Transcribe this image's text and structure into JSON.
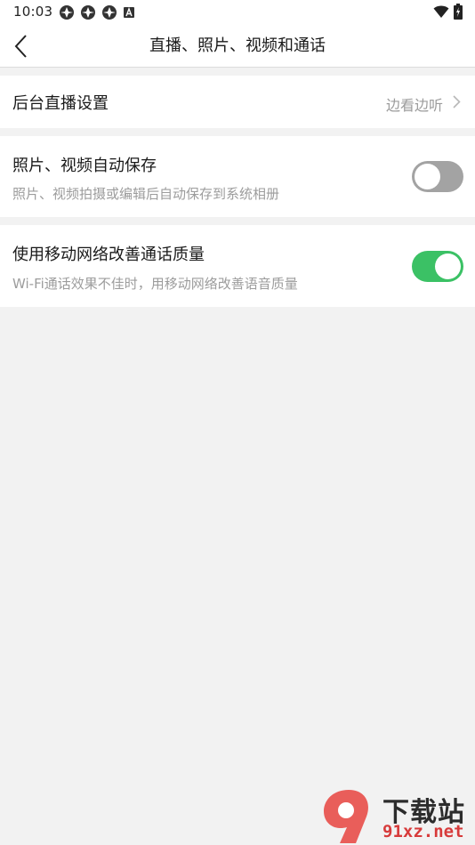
{
  "status_bar": {
    "time": "10:03",
    "notification_icons": [
      "app-icon",
      "app-icon",
      "app-icon",
      "a-icon"
    ],
    "right_icons": [
      "wifi-icon",
      "battery-charging-icon"
    ]
  },
  "nav": {
    "back_icon": "back-arrow-icon",
    "title": "直播、照片、视频和通话"
  },
  "settings": {
    "live": {
      "title": "后台直播设置",
      "value": "边看边听"
    },
    "photo": {
      "title": "照片、视频自动保存",
      "desc": "照片、视频拍摄或编辑后自动保存到系统相册",
      "enabled": false
    },
    "network": {
      "title": "使用移动网络改善通话质量",
      "desc": "Wi-Fi通话效果不佳时，用移动网络改善语音质量",
      "enabled": true
    }
  },
  "colors": {
    "switch_on": "#3bc165",
    "switch_off": "#a3a3a3",
    "background": "#f2f2f2"
  },
  "watermark": {
    "logo_text": "9",
    "text": "下载站",
    "url": "91xz.net"
  }
}
